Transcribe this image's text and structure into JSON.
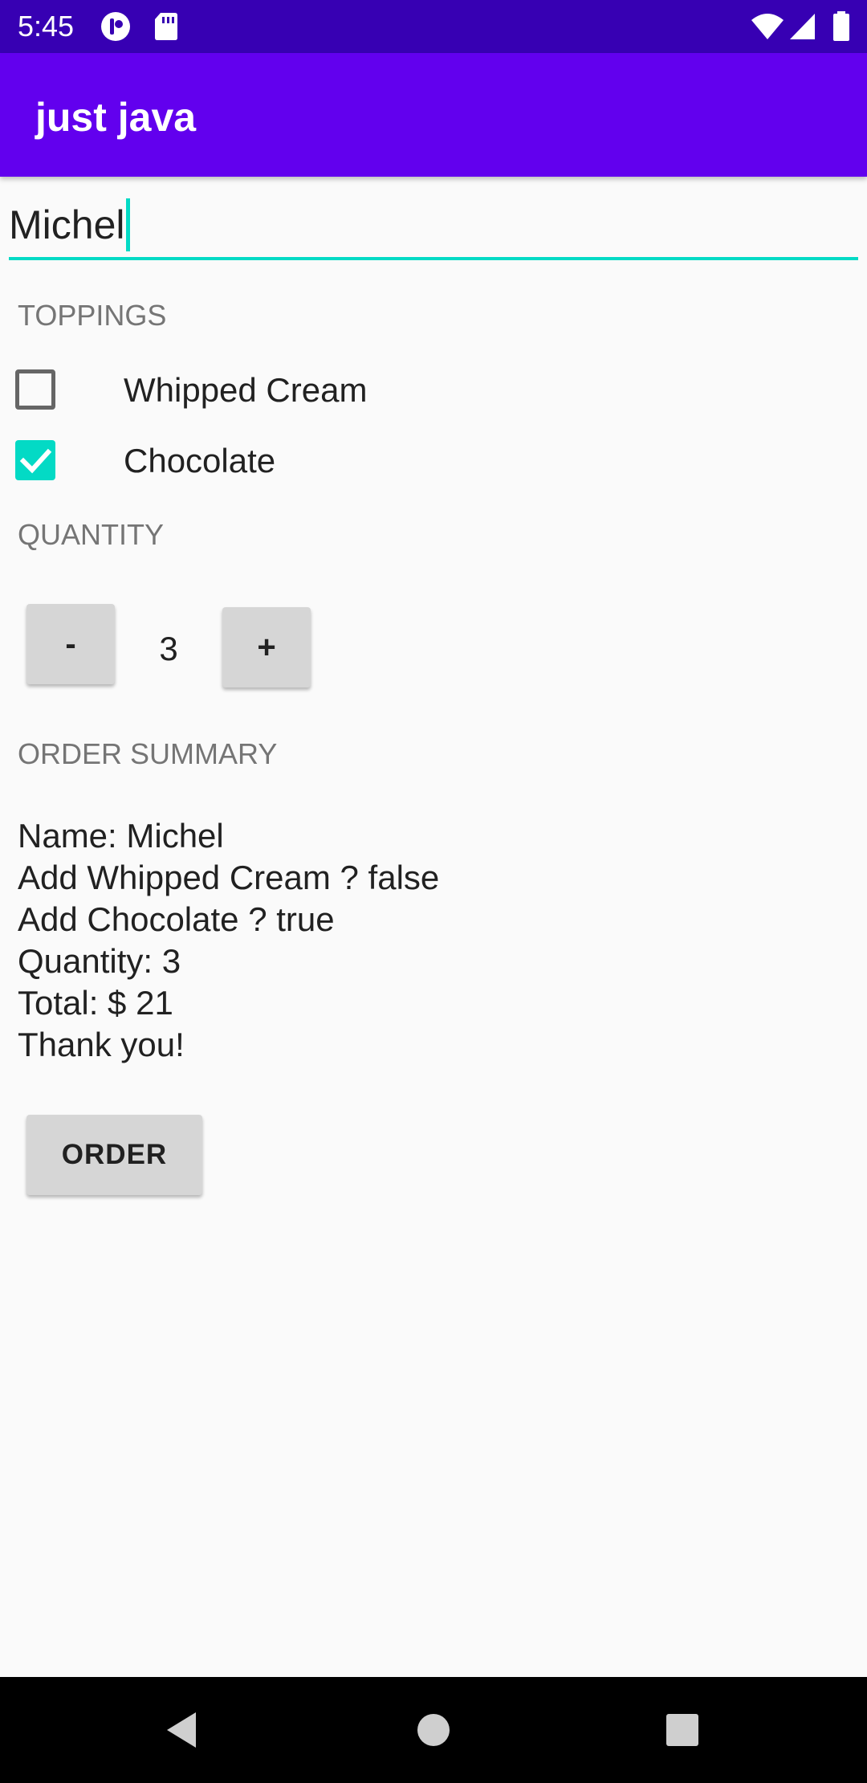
{
  "status_bar": {
    "time": "5:45",
    "icons_left": [
      "app-notification-icon",
      "sd-card-icon"
    ],
    "icons_right": [
      "wifi-icon",
      "cell-signal-icon",
      "battery-icon"
    ],
    "background": "#3700b3"
  },
  "app_bar": {
    "title": "just java",
    "background": "#6200ee"
  },
  "name_field": {
    "value": "Michel",
    "accent": "#03dac5"
  },
  "toppings": {
    "label": "TOPPINGS",
    "items": [
      {
        "label": "Whipped Cream",
        "checked": false
      },
      {
        "label": "Chocolate",
        "checked": true
      }
    ]
  },
  "quantity": {
    "label": "QUANTITY",
    "decrement_label": "-",
    "value": "3",
    "increment_label": "+"
  },
  "order_summary": {
    "label": "ORDER SUMMARY",
    "lines": [
      "Name: Michel",
      "Add Whipped Cream ? false",
      "Add Chocolate ? true",
      "Quantity: 3",
      "Total: $ 21",
      "Thank you!"
    ]
  },
  "order_button": {
    "label": "ORDER"
  },
  "nav_bar": {
    "buttons": [
      "back-icon",
      "home-icon",
      "recents-icon"
    ]
  }
}
